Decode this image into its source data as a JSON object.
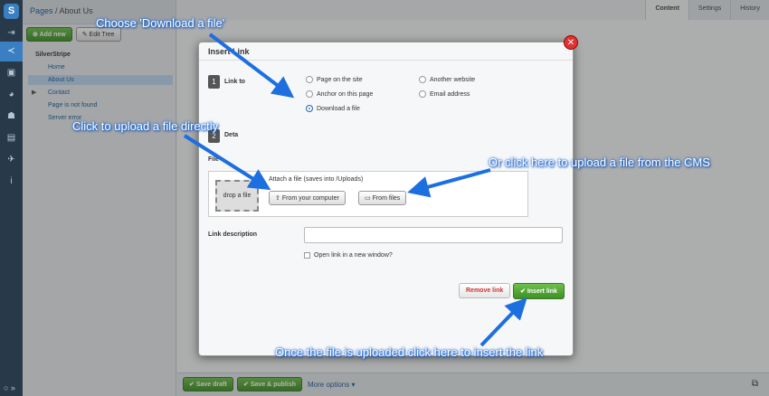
{
  "cms": {
    "breadcrumb_section": "Pages",
    "breadcrumb_sep": " / ",
    "breadcrumb_page": "About Us",
    "tabs": [
      "Content",
      "Settings",
      "History"
    ],
    "add_new": "Add new",
    "edit_tree": "Edit Tree",
    "tree": {
      "root": "SilverStripe",
      "items": [
        "Home",
        "About Us",
        "Contact",
        "Page is not found",
        "Server error"
      ]
    },
    "save_draft": "Save draft",
    "save_publish": "Save & publish",
    "more_options": "More options"
  },
  "dialog": {
    "title": "Insert Link",
    "close_icon": "close-icon",
    "step1": "1",
    "link_to_label": "Link to",
    "link_options": [
      {
        "label": "Page on the site",
        "selected": false
      },
      {
        "label": "Another website",
        "selected": false
      },
      {
        "label": "Anchor on this page",
        "selected": false
      },
      {
        "label": "Email address",
        "selected": false
      },
      {
        "label": "Download a file",
        "selected": true
      }
    ],
    "step2": "2",
    "details_label": "Deta",
    "file_label": "File",
    "drop_label": "drop a file",
    "attach_text": "Attach a file (saves into /Uploads)",
    "from_computer": "From your computer",
    "from_files": "From files",
    "link_description_label": "Link description",
    "link_description_value": "",
    "open_new_window": "Open link in a new window?",
    "remove_link": "Remove link",
    "insert_link": "Insert link"
  },
  "annotations": {
    "a1": "Choose 'Download a file'",
    "a2": "Click to upload a file directly",
    "a3": "Or click here to upload a file from the CMS",
    "a4": "Once the file is uploaded click here to insert the link"
  },
  "colors": {
    "accent": "#3a7fc1",
    "annotation": "#1d6fe0",
    "insert": "#4a9d2d",
    "close": "#d33333"
  }
}
